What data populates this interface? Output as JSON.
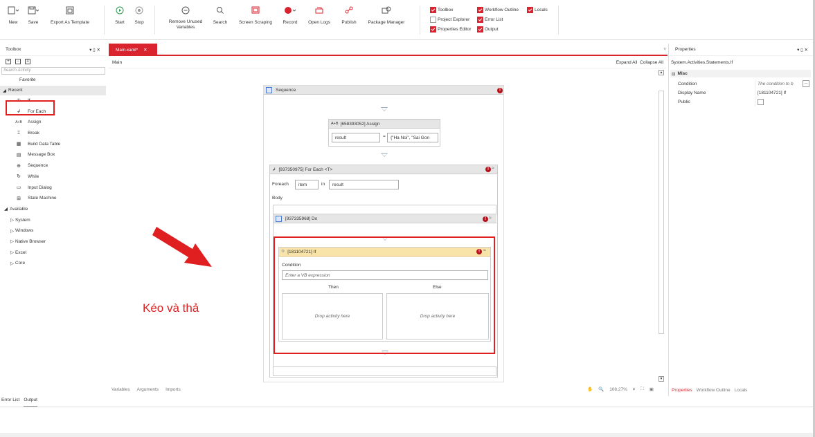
{
  "ribbon": {
    "new": "New",
    "save": "Save",
    "export": "Export As Template",
    "start": "Start",
    "stop": "Stop",
    "remove_unused": "Remove Unused",
    "variables": "Variables",
    "search": "Search",
    "screen_scraping": "Screen Scraping",
    "record": "Record",
    "open_logs": "Open Logs",
    "publish": "Publish",
    "package_manager": "Package Manager",
    "panels": {
      "toolbox": "Toolbox",
      "project_explorer": "Project Explorer",
      "properties_editor": "Properties Editor",
      "workflow_outline": "Workflow Outline",
      "error_list": "Error List",
      "output": "Output",
      "locals": "Locals"
    }
  },
  "toolbox": {
    "title": "Toolbox",
    "controls": "▾ ▯ ✕",
    "search_placeholder": "Search Activity",
    "favorite": "Favorite",
    "recent": "Recent",
    "recent_items": [
      {
        "label": "If",
        "icon": "if-icon"
      },
      {
        "label": "For Each",
        "icon": "foreach-icon"
      },
      {
        "label": "Assign",
        "icon": "assign-icon"
      },
      {
        "label": "Break",
        "icon": "break-icon"
      },
      {
        "label": "Build Data Table",
        "icon": "datatable-icon"
      },
      {
        "label": "Message Box",
        "icon": "message-icon"
      },
      {
        "label": "Sequence",
        "icon": "sequence-icon"
      },
      {
        "label": "While",
        "icon": "while-icon"
      },
      {
        "label": "Input Dialog",
        "icon": "input-icon"
      },
      {
        "label": "State Machine",
        "icon": "statemachine-icon"
      }
    ],
    "available": "Available",
    "groups": [
      "System",
      "Windows",
      "Native Browser",
      "Excel",
      "Core"
    ]
  },
  "document": {
    "tab": "Main.xaml*",
    "breadcrumb": "Main",
    "expand_all": "Expand All",
    "collapse_all": "Collapse All"
  },
  "workflow": {
    "sequence": "Sequence",
    "assign_title": "[658393052] Assign",
    "assign_to": "result",
    "assign_value": "{\"Ha Noi\", \"Sai Gon",
    "foreach_title": "[937350975] For Each <T>",
    "foreach_label": "Foreach",
    "foreach_item": "item",
    "foreach_in": "in",
    "foreach_values": "result",
    "body": "Body",
    "do_title": "[937335968] Do",
    "if_title": "[181104721] If",
    "condition": "Condition",
    "condition_placeholder": "Enter a VB expression",
    "then": "Then",
    "else": "Else",
    "drop_then": "Drop activity here",
    "drop_else": "Drop activity here"
  },
  "annotation": "Kéo và thả",
  "designer_bottom": {
    "variables": "Variables",
    "arguments": "Arguments",
    "imports": "Imports",
    "zoom": "108.27%"
  },
  "properties": {
    "title": "Properties",
    "type": "System.Activities.Statements.If",
    "category": "Misc",
    "rows": [
      {
        "name": "Condition",
        "value": "The condition to b"
      },
      {
        "name": "Display Name",
        "value": "[181104721] If"
      },
      {
        "name": "Public",
        "value": ""
      }
    ],
    "tabs": [
      "Properties",
      "Workflow Outline",
      "Locals"
    ]
  },
  "output_tabs": [
    "Error List",
    "Output"
  ],
  "colors": {
    "accent": "#d9232e",
    "annotation": "#e02020"
  }
}
